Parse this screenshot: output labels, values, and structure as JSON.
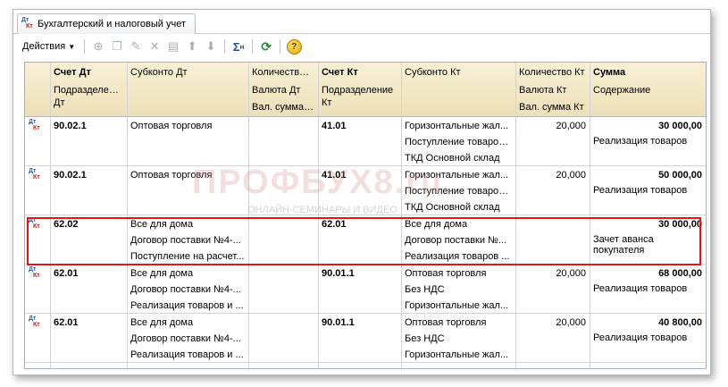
{
  "tab": {
    "title": "Бухгалтерский и налоговый учет",
    "icon_dt": "Дт",
    "icon_kt": "Кт"
  },
  "toolbar": {
    "actions_label": "Действия",
    "icons": [
      "add-icon",
      "copy-icon",
      "edit-icon",
      "delete-icon",
      "post-icon",
      "move-up-icon",
      "move-down-icon",
      "sum-icon",
      "refresh-icon",
      "help-icon"
    ],
    "help_glyph": "?"
  },
  "columns": {
    "row1": [
      "Счет Дт",
      "Субконто Дт",
      "Количество ...",
      "Счет Кт",
      "Субконто Кт",
      "Количество Кт",
      "Сумма"
    ],
    "row2": [
      "Подразделение Дт",
      "Валюта Дт",
      "Подразделение Кт",
      "Валюта Кт",
      "Содержание"
    ],
    "row3": [
      "Вал. сумма ...",
      "Вал. сумма Кт"
    ]
  },
  "rows": [
    {
      "dt_account": "90.02.1",
      "dt_sub": [
        "Оптовая торговля",
        "",
        ""
      ],
      "dt_qty": "",
      "kt_account": "41.01",
      "kt_sub": [
        "Горизонтальные жал...",
        "Поступление товаров ...",
        "ТКД Основной склад"
      ],
      "kt_qty": "20,000",
      "amount": "30 000,00",
      "content": "Реализация товаров"
    },
    {
      "dt_account": "90.02.1",
      "dt_sub": [
        "Оптовая торговля",
        "",
        ""
      ],
      "dt_qty": "",
      "kt_account": "41.01",
      "kt_sub": [
        "Горизонтальные жал...",
        "Поступление товаров ...",
        "ТКД Основной склад"
      ],
      "kt_qty": "20,000",
      "amount": "50 000,00",
      "content": "Реализация товаров"
    },
    {
      "dt_account": "62.02",
      "dt_sub": [
        "Все для дома",
        "Договор поставки №4-...",
        "Поступление на расчет..."
      ],
      "dt_qty": "",
      "kt_account": "62.01",
      "kt_sub": [
        "Все для дома",
        "Договор поставки №...",
        "Реализация товаров ..."
      ],
      "kt_qty": "",
      "amount": "30 000,00",
      "content": "Зачет аванса покупателя"
    },
    {
      "dt_account": "62.01",
      "dt_sub": [
        "Все для дома",
        "Договор поставки №4-...",
        "Реализация товаров и ..."
      ],
      "dt_qty": "",
      "kt_account": "90.01.1",
      "kt_sub": [
        "Оптовая торговля",
        "Без НДС",
        "Горизонтальные жал..."
      ],
      "kt_qty": "20,000",
      "amount": "68 000,00",
      "content": "Реализация товаров"
    },
    {
      "dt_account": "62.01",
      "dt_sub": [
        "Все для дома",
        "Договор поставки №4-...",
        "Реализация товаров и ..."
      ],
      "dt_qty": "",
      "kt_account": "90.01.1",
      "kt_sub": [
        "Оптовая торговля",
        "Без НДС",
        "Горизонтальные жал..."
      ],
      "kt_qty": "20,000",
      "amount": "40 800,00",
      "content": "Реализация товаров"
    }
  ],
  "watermark": {
    "main": "ПРОФБУХ8.ru",
    "sub": "ОНЛАЙН-СЕМИНАРЫ И ВИДЕО"
  }
}
